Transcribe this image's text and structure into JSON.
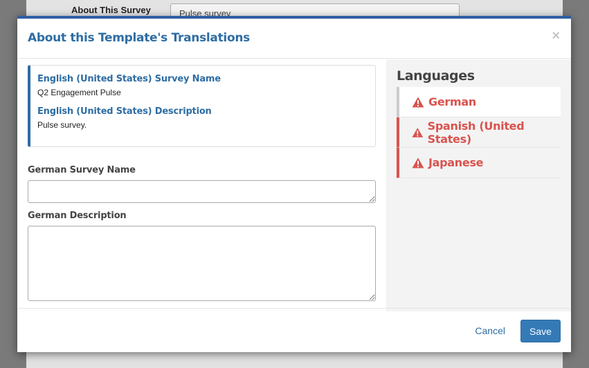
{
  "background": {
    "label": "About This Survey",
    "input_value": "Pulse survey"
  },
  "modal": {
    "title": "About this Template's Translations",
    "close_glyph": "×"
  },
  "reference": {
    "name_label": "English (United States) Survey Name",
    "name_value": "Q2 Engagement Pulse",
    "description_label": "English (United States) Description",
    "description_value": "Pulse survey."
  },
  "form": {
    "name_label": "German Survey Name",
    "name_value": "",
    "description_label": "German Description",
    "description_value": ""
  },
  "languages": {
    "heading": "Languages",
    "items": [
      {
        "label": "German",
        "status": "warning",
        "active": true
      },
      {
        "label": "Spanish (United States)",
        "status": "warning",
        "active": false
      },
      {
        "label": "Japanese",
        "status": "warning",
        "active": false
      }
    ]
  },
  "footer": {
    "cancel_label": "Cancel",
    "save_label": "Save"
  },
  "colors": {
    "accent": "#2e6da4",
    "warning": "#d9534f",
    "primary_button": "#337ab7"
  }
}
